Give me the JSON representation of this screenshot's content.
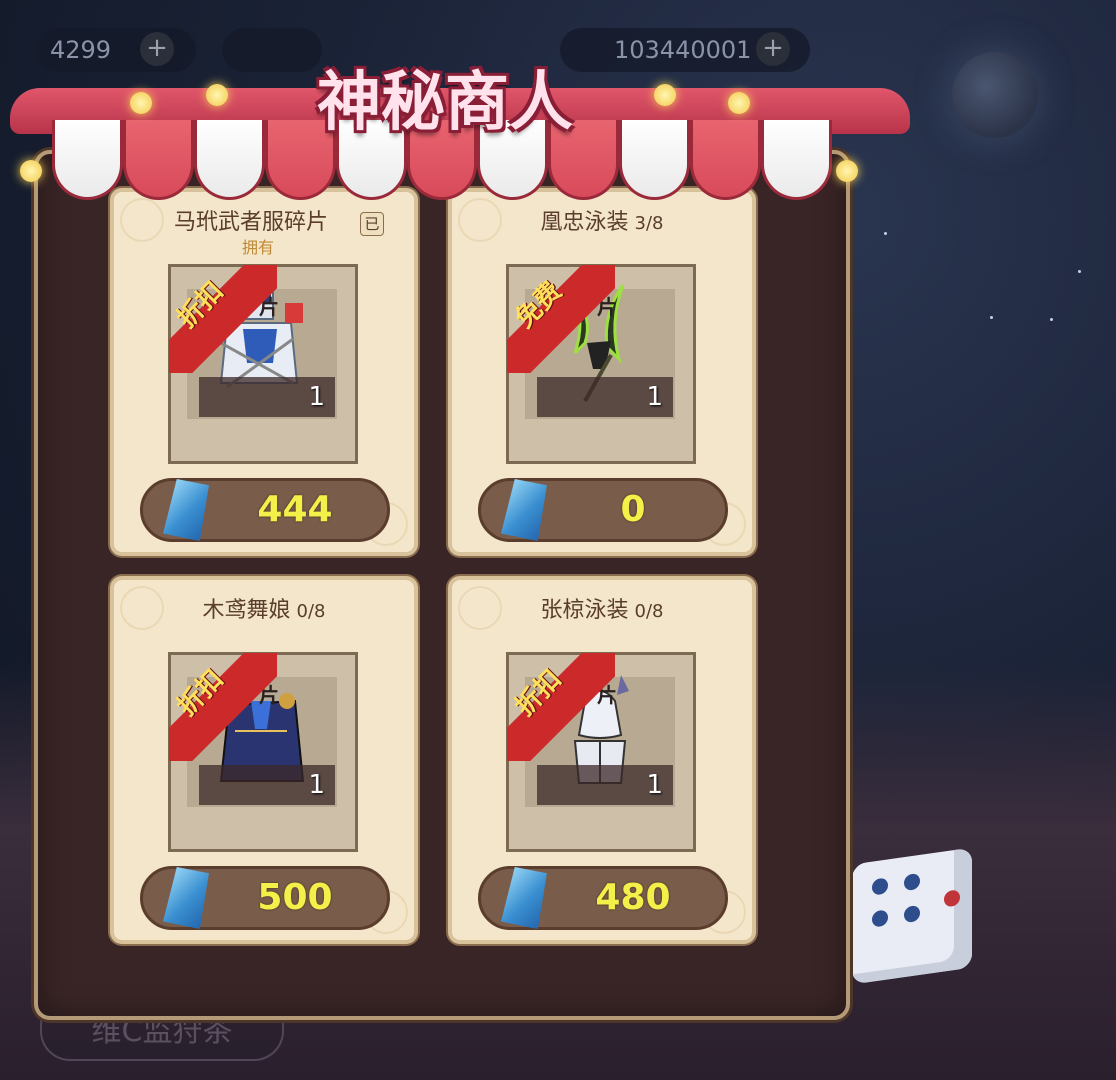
{
  "hud": {
    "resource_1": "4299",
    "resource_3": "103440001",
    "plus_symbol": "+"
  },
  "title": "神秘商人",
  "chip_label": "片",
  "cards": [
    {
      "name": "马玳武者服碎片",
      "count": "",
      "owned": "拥有",
      "owned_tag": "已",
      "badge": "折扣",
      "qty": "1",
      "price": "444",
      "art": "shield-armor-icon"
    },
    {
      "name": "凰忠泳装",
      "count": "3/8",
      "owned": "",
      "owned_tag": "",
      "badge": "免费",
      "qty": "1",
      "price": "0",
      "art": "green-blade-icon"
    },
    {
      "name": "木鸢舞娘",
      "count": "0/8",
      "owned": "",
      "owned_tag": "",
      "badge": "折扣",
      "qty": "1",
      "price": "500",
      "art": "blue-dancer-icon"
    },
    {
      "name": "张椋泳装",
      "count": "0/8",
      "owned": "",
      "owned_tag": "",
      "badge": "折扣",
      "qty": "1",
      "price": "480",
      "art": "white-swimsuit-icon"
    }
  ],
  "bottom_button": "维C监狩茶",
  "colors": {
    "panel": "#3a2526",
    "card": "#f4e6cb",
    "price_text": "#f3f04a",
    "badge": "#cc2a2a",
    "badge_text": "#ffe05a"
  }
}
